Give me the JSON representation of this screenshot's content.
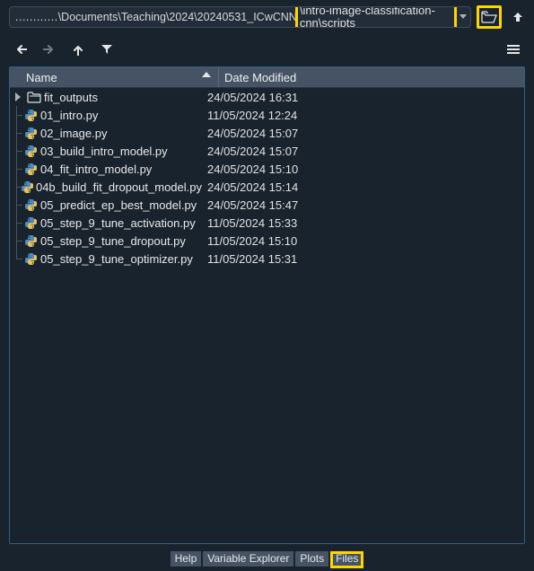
{
  "path": {
    "prefix_dots": "............",
    "prefix": " \\Documents\\Teaching\\2024\\20240531_ICwCNN",
    "highlighted": "\\intro-image-classification-cnn\\scripts"
  },
  "columns": {
    "name": "Name",
    "date": "Date Modified"
  },
  "rows": [
    {
      "kind": "folder",
      "expandable": true,
      "name": "fit_outputs",
      "date": "24/05/2024 16:31"
    },
    {
      "kind": "py",
      "name": "01_intro.py",
      "date": "11/05/2024 12:24"
    },
    {
      "kind": "py",
      "name": "02_image.py",
      "date": "24/05/2024 15:07"
    },
    {
      "kind": "py",
      "name": "03_build_intro_model.py",
      "date": "24/05/2024 15:07"
    },
    {
      "kind": "py",
      "name": "04_fit_intro_model.py",
      "date": "24/05/2024 15:10"
    },
    {
      "kind": "py",
      "name": "04b_build_fit_dropout_model.py",
      "date": "24/05/2024 15:14"
    },
    {
      "kind": "py",
      "name": "05_predict_ep_best_model.py",
      "date": "24/05/2024 15:47"
    },
    {
      "kind": "py",
      "name": "05_step_9_tune_activation.py",
      "date": "11/05/2024 15:33"
    },
    {
      "kind": "py",
      "name": "05_step_9_tune_dropout.py",
      "date": "11/05/2024 15:10"
    },
    {
      "kind": "py",
      "last": true,
      "name": "05_step_9_tune_optimizer.py",
      "date": "11/05/2024 15:31"
    }
  ],
  "tabs": [
    {
      "label": "Help",
      "active": false
    },
    {
      "label": "Variable Explorer",
      "active": false
    },
    {
      "label": "Plots",
      "active": false
    },
    {
      "label": "Files",
      "active": true
    }
  ]
}
